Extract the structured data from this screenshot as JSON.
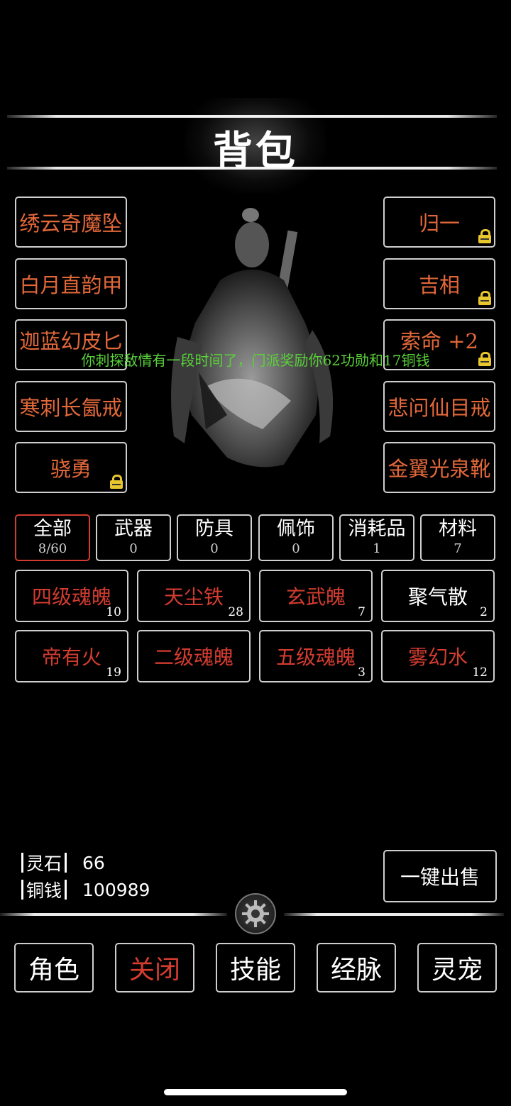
{
  "header": {
    "title": "背包"
  },
  "notice": "你刺探敌情有一段时间了，门派奖励你62功勋和17铜钱",
  "equipment": {
    "left": [
      {
        "label": "绣云奇魔坠",
        "locked": false
      },
      {
        "label": "白月直韵甲",
        "locked": false
      },
      {
        "label": "迦蓝幻皮匕",
        "locked": false
      },
      {
        "label": "寒刺长氤戒",
        "locked": false
      },
      {
        "label": "骁勇",
        "locked": true
      }
    ],
    "right": [
      {
        "label": "归一",
        "locked": true
      },
      {
        "label": "吉相",
        "locked": true
      },
      {
        "label": "索命 +2",
        "locked": true
      },
      {
        "label": "悲问仙目戒",
        "locked": false
      },
      {
        "label": "金翼光泉靴",
        "locked": false
      }
    ]
  },
  "tabs": [
    {
      "label": "全部",
      "count": "8/60",
      "active": true
    },
    {
      "label": "武器",
      "count": "0",
      "active": false
    },
    {
      "label": "防具",
      "count": "0",
      "active": false
    },
    {
      "label": "佩饰",
      "count": "0",
      "active": false
    },
    {
      "label": "消耗品",
      "count": "1",
      "active": false
    },
    {
      "label": "材料",
      "count": "7",
      "active": false
    }
  ],
  "items": [
    {
      "name": "四级魂魄",
      "qty": "10",
      "color": "#d43c30"
    },
    {
      "name": "天尘铁",
      "qty": "28",
      "color": "#d43c30"
    },
    {
      "name": "玄武魄",
      "qty": "7",
      "color": "#d43c30"
    },
    {
      "name": "聚气散",
      "qty": "2",
      "color": "#ffffff"
    },
    {
      "name": "帝有火",
      "qty": "19",
      "color": "#d43c30"
    },
    {
      "name": "二级魂魄",
      "qty": "",
      "color": "#d43c30"
    },
    {
      "name": "五级魂魄",
      "qty": "3",
      "color": "#d43c30"
    },
    {
      "name": "雾幻水",
      "qty": "12",
      "color": "#d43c30"
    }
  ],
  "currency": {
    "spirit_stone": {
      "label": "灵石",
      "value": "66"
    },
    "copper": {
      "label": "铜钱",
      "value": "100989"
    }
  },
  "sell_all_label": "一键出售",
  "nav": [
    {
      "label": "角色",
      "highlight": false
    },
    {
      "label": "关闭",
      "highlight": true
    },
    {
      "label": "技能",
      "highlight": false
    },
    {
      "label": "经脉",
      "highlight": false
    },
    {
      "label": "灵宠",
      "highlight": false
    }
  ],
  "colors": {
    "slot_text": "#e2683a",
    "accent_red": "#d43c30",
    "notice_green": "#5ad13a",
    "lock_yellow": "#e8c62e"
  }
}
